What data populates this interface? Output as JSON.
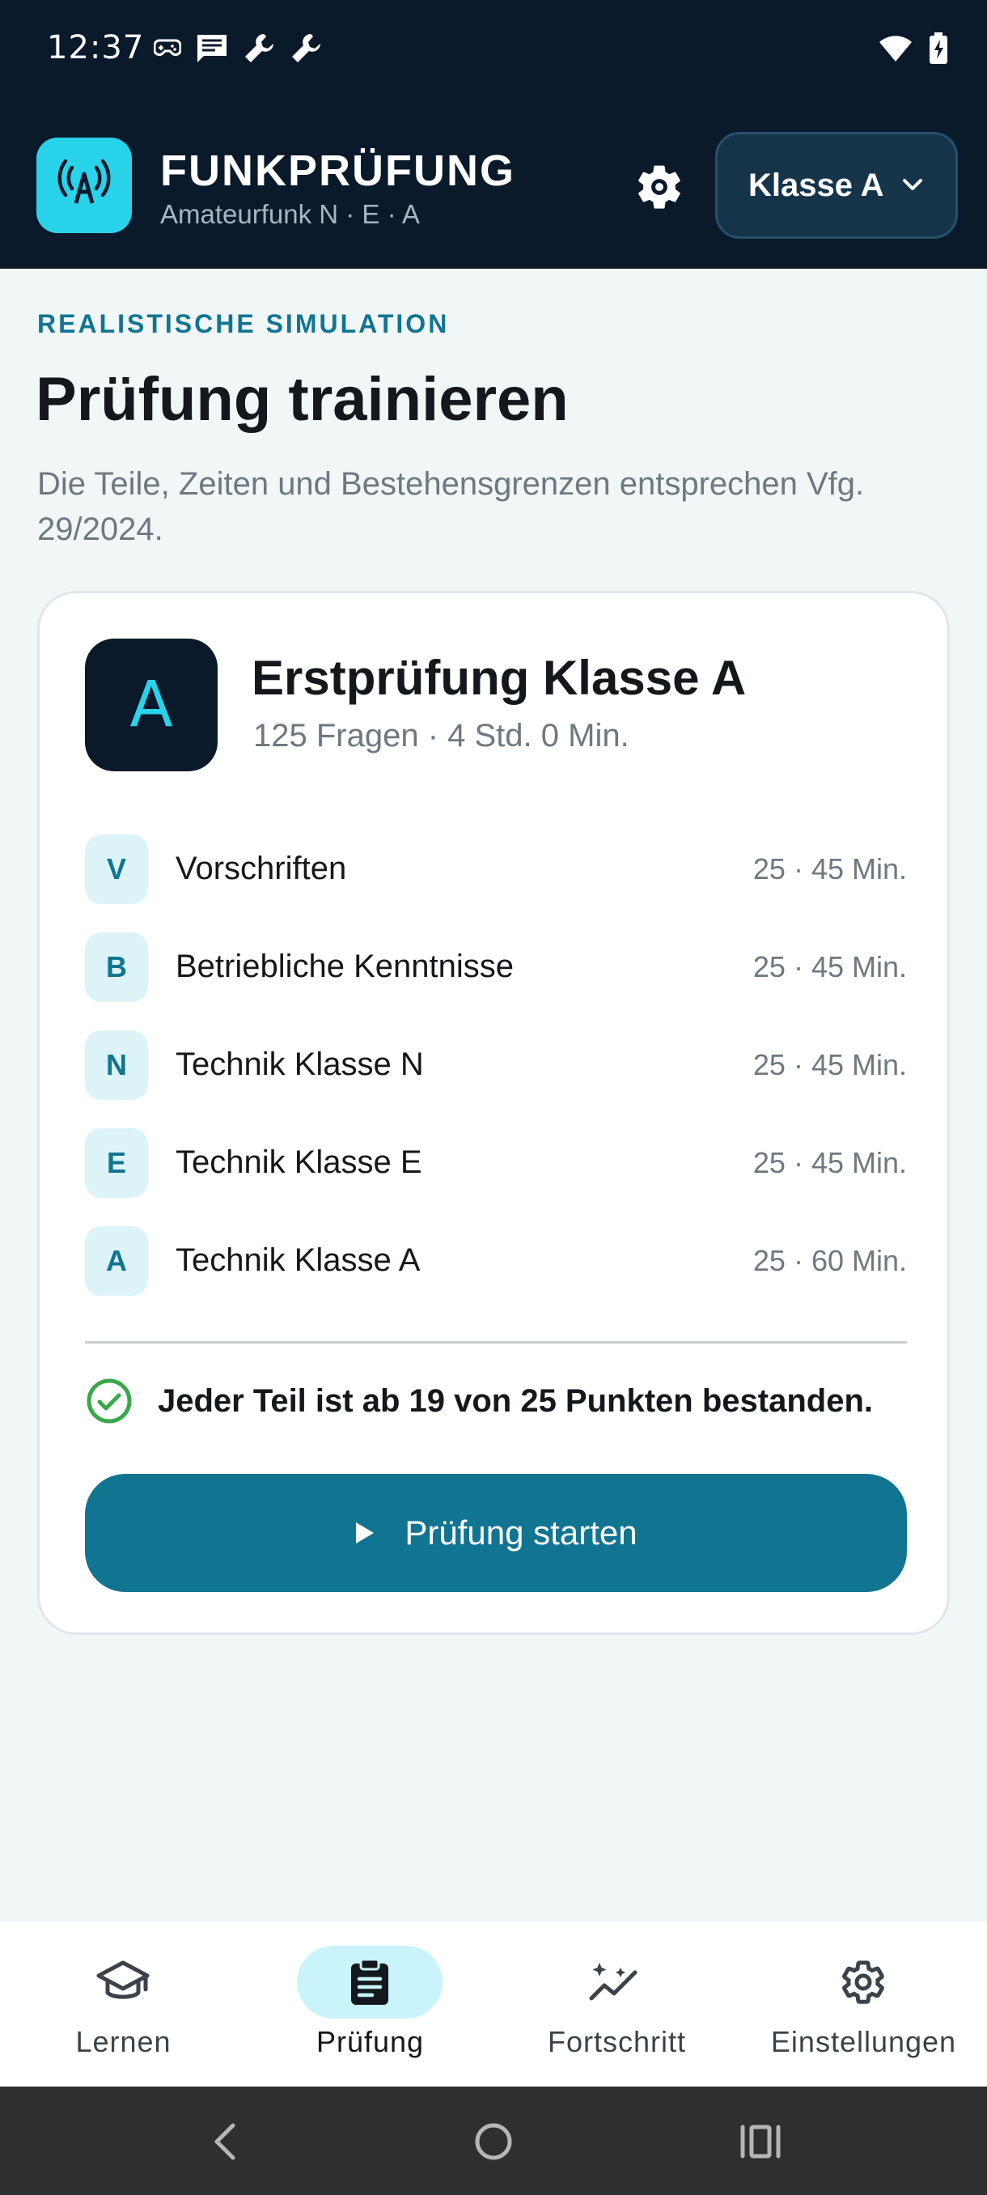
{
  "status_bar": {
    "time": "12:37",
    "left_icons": [
      "gamepad-icon",
      "message-icon",
      "wrench-icon",
      "wrench-icon"
    ],
    "right_icons": [
      "wifi-icon",
      "battery-charging-icon"
    ]
  },
  "header": {
    "app_title": "FUNKPRÜFUNG",
    "app_subtitle": "Amateurfunk N · E · A",
    "class_select": "Klasse A"
  },
  "content": {
    "eyebrow": "REALISTISCHE SIMULATION",
    "title": "Prüfung trainieren",
    "description": "Die Teile, Zeiten und Bestehensgrenzen entsprechen Vfg. 29/2024."
  },
  "exam": {
    "badge": "A",
    "title": "Erstprüfung Klasse A",
    "subtitle": "125 Fragen · 4 Std. 0 Min.",
    "parts": [
      {
        "letter": "V",
        "name": "Vorschriften",
        "meta": "25 · 45 Min."
      },
      {
        "letter": "B",
        "name": "Betriebliche Kenntnisse",
        "meta": "25 · 45 Min."
      },
      {
        "letter": "N",
        "name": "Technik Klasse N",
        "meta": "25 · 45 Min."
      },
      {
        "letter": "E",
        "name": "Technik Klasse E",
        "meta": "25 · 45 Min."
      },
      {
        "letter": "A",
        "name": "Technik Klasse A",
        "meta": "25 · 60 Min."
      }
    ],
    "rule": "Jeder Teil ist ab 19 von 25 Punkten bestanden.",
    "start_label": "Prüfung starten"
  },
  "bottom_nav": {
    "items": [
      {
        "label": "Lernen",
        "icon": "graduation-cap-icon"
      },
      {
        "label": "Prüfung",
        "icon": "clipboard-icon",
        "active": true
      },
      {
        "label": "Fortschritt",
        "icon": "chart-sparkle-icon"
      },
      {
        "label": "Einstellungen",
        "icon": "gear-icon"
      }
    ]
  },
  "colors": {
    "header_bg": "#0a1a2b",
    "accent": "#117592",
    "logo": "#29d3ea",
    "success": "#3aa84a"
  }
}
